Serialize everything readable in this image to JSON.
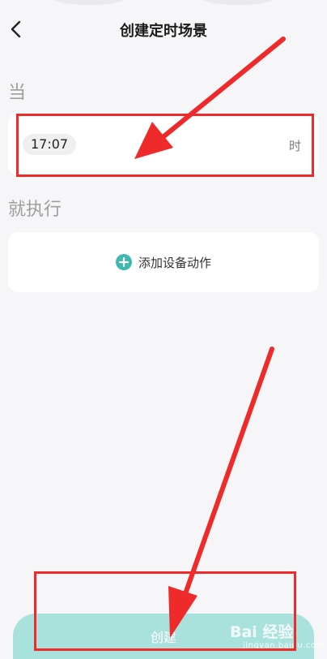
{
  "header": {
    "title": "创建定时场景",
    "back_icon": "chevron-left-icon"
  },
  "when_section": {
    "label": "当",
    "time": "17:07",
    "unit": "时"
  },
  "do_section": {
    "label": "就执行",
    "add_action_label": "添加设备动作",
    "add_icon": "plus-circle-icon"
  },
  "footer": {
    "create_label": "创建"
  },
  "watermark": {
    "main": "Bai 经验",
    "sub": "jingyan.baidu.com"
  },
  "colors": {
    "accent": "#3fb8b0",
    "create_button": "#a9e2dd",
    "annotation_red": "#ee2a2a",
    "background": "#f6f6f8"
  }
}
